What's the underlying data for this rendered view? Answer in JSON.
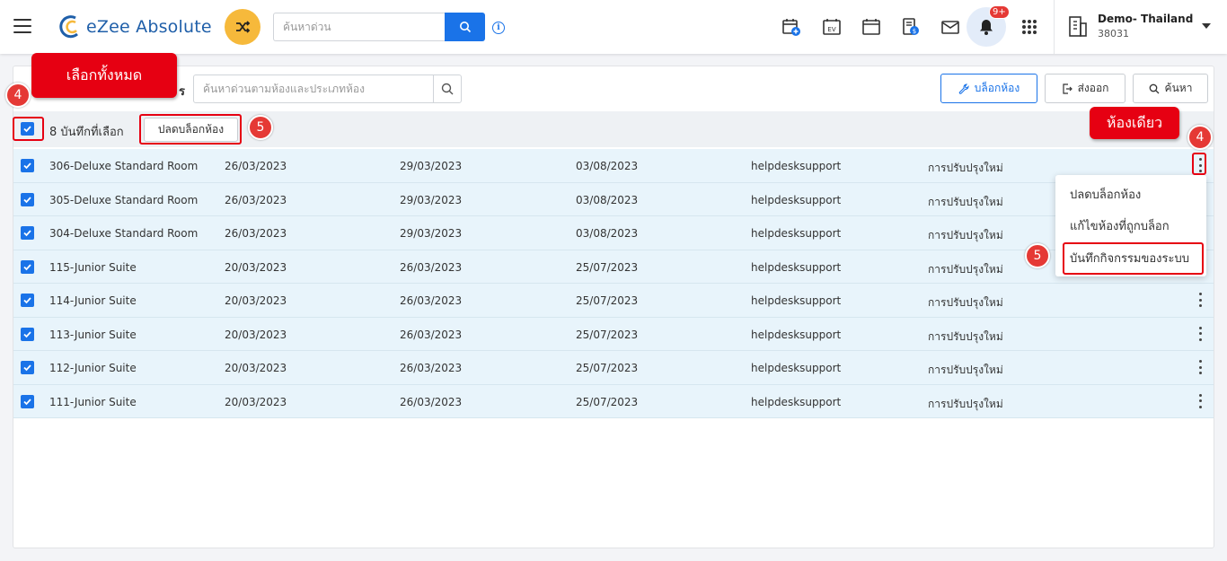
{
  "app": {
    "name": "eZee Absolute",
    "quick_search_placeholder": "ค้นหาด่วน",
    "notification_badge": "9+",
    "hotel_name": "Demo- Thailand",
    "hotel_code": "38031"
  },
  "toolbar": {
    "filter_label": "ร",
    "room_search_placeholder": "ค้นหาด่วนตามห้องและประเภทห้อง",
    "block_room_label": "บล็อกห้อง",
    "export_label": "ส่งออก",
    "search_label": "ค้นหา"
  },
  "selection": {
    "count_label": "8 บันทึกที่เลือก",
    "unblock_label": "ปลดบล็อกห้อง"
  },
  "rows": [
    {
      "room": "306-Deluxe Standard Room",
      "from": "26/03/2023",
      "to": "29/03/2023",
      "date": "03/08/2023",
      "user": "helpdesksupport",
      "reason": "การปรับปรุงใหม่"
    },
    {
      "room": "305-Deluxe Standard Room",
      "from": "26/03/2023",
      "to": "29/03/2023",
      "date": "03/08/2023",
      "user": "helpdesksupport",
      "reason": "การปรับปรุงใหม่"
    },
    {
      "room": "304-Deluxe Standard Room",
      "from": "26/03/2023",
      "to": "29/03/2023",
      "date": "03/08/2023",
      "user": "helpdesksupport",
      "reason": "การปรับปรุงใหม่"
    },
    {
      "room": "115-Junior Suite",
      "from": "20/03/2023",
      "to": "26/03/2023",
      "date": "25/07/2023",
      "user": "helpdesksupport",
      "reason": "การปรับปรุงใหม่"
    },
    {
      "room": "114-Junior Suite",
      "from": "20/03/2023",
      "to": "26/03/2023",
      "date": "25/07/2023",
      "user": "helpdesksupport",
      "reason": "การปรับปรุงใหม่"
    },
    {
      "room": "113-Junior Suite",
      "from": "20/03/2023",
      "to": "26/03/2023",
      "date": "25/07/2023",
      "user": "helpdesksupport",
      "reason": "การปรับปรุงใหม่"
    },
    {
      "room": "112-Junior Suite",
      "from": "20/03/2023",
      "to": "26/03/2023",
      "date": "25/07/2023",
      "user": "helpdesksupport",
      "reason": "การปรับปรุงใหม่"
    },
    {
      "room": "111-Junior Suite",
      "from": "20/03/2023",
      "to": "26/03/2023",
      "date": "25/07/2023",
      "user": "helpdesksupport",
      "reason": "การปรับปรุงใหม่"
    }
  ],
  "row_menu": {
    "unblock": "ปลดบล็อกห้อง",
    "edit_blocked": "แก้ไขห้องที่ถูกบล็อก",
    "audit_trail": "บันทึกกิจกรรมของระบบ"
  },
  "annotations": {
    "select_all": "เลือกทั้งหมด",
    "single_room": "ห้องเดียว",
    "step_4": "4",
    "step_5": "5"
  },
  "colors": {
    "primary": "#1a73e8",
    "row_bg": "#e8f4fb",
    "annotation_red": "#e60012",
    "shuffle_bg": "#f6b93b"
  }
}
